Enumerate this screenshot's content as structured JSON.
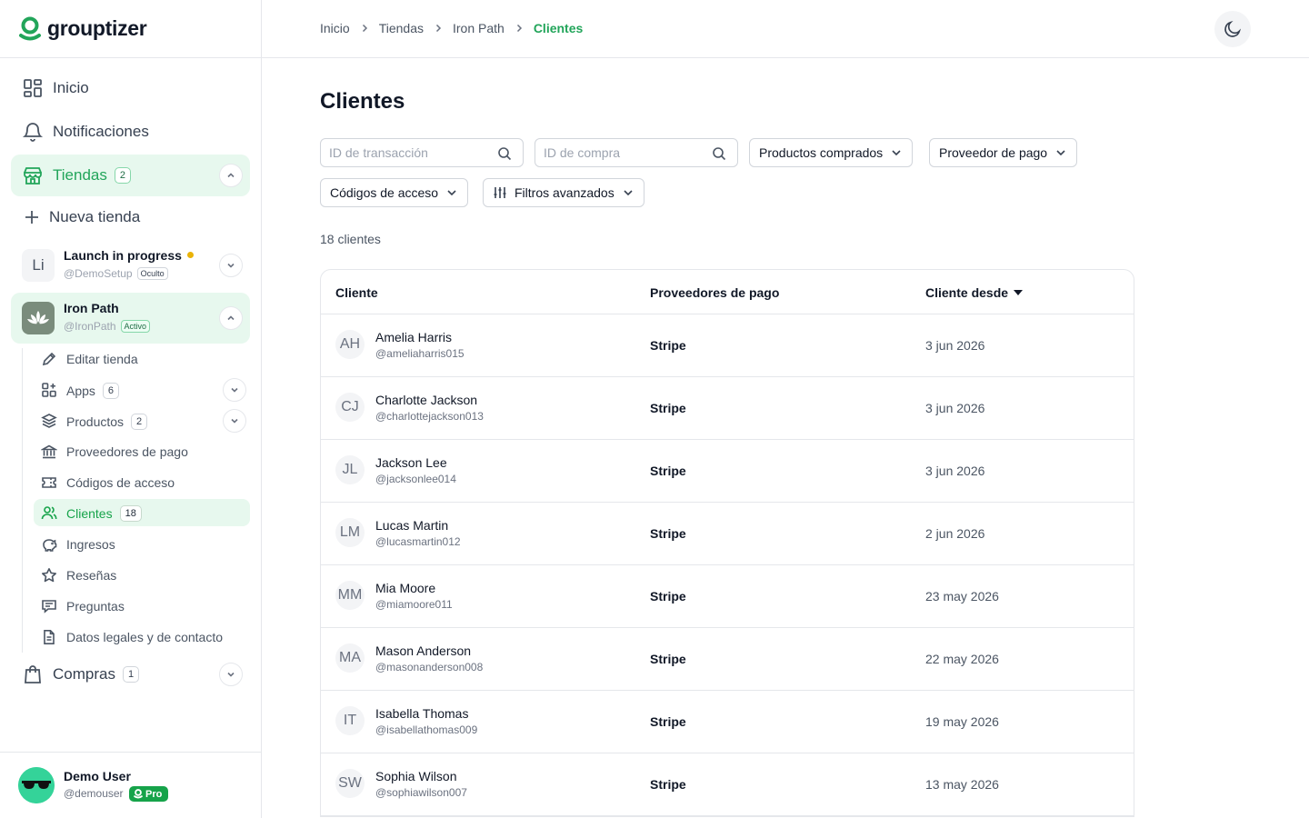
{
  "brand": {
    "name": "grouptizer"
  },
  "sidebar": {
    "home": "Inicio",
    "notifications": "Notificaciones",
    "stores": {
      "label": "Tiendas",
      "count": "2"
    },
    "new_store": "Nueva tienda",
    "store_list": [
      {
        "initials": "Li",
        "name": "Launch in progress",
        "handle": "@DemoSetup",
        "tag": "Oculto",
        "status_dot": "#eab308"
      },
      {
        "initials": "",
        "name": "Iron Path",
        "handle": "@IronPath",
        "tag": "Activo"
      }
    ],
    "store_menu": {
      "edit": "Editar tienda",
      "apps": {
        "label": "Apps",
        "count": "6"
      },
      "products": {
        "label": "Productos",
        "count": "2"
      },
      "payment_providers": "Proveedores de pago",
      "access_codes": "Códigos de acceso",
      "clients": {
        "label": "Clientes",
        "count": "18"
      },
      "income": "Ingresos",
      "reviews": "Reseñas",
      "questions": "Preguntas",
      "legal": "Datos legales y de contacto"
    },
    "purchases": {
      "label": "Compras",
      "count": "1"
    },
    "user": {
      "name": "Demo User",
      "handle": "@demouser",
      "plan": "Pro"
    }
  },
  "breadcrumb": [
    "Inicio",
    "Tiendas",
    "Iron Path",
    "Clientes"
  ],
  "page": {
    "title": "Clientes",
    "filters": {
      "transaction_placeholder": "ID de transacción",
      "purchase_placeholder": "ID de compra",
      "products": "Productos comprados",
      "provider": "Proveedor de pago",
      "access_codes": "Códigos de acceso",
      "advanced": "Filtros avanzados"
    },
    "count_label": "18 clientes"
  },
  "table": {
    "columns": [
      "Cliente",
      "Proveedores de pago",
      "Cliente desde"
    ],
    "rows": [
      {
        "initials": "AH",
        "name": "Amelia Harris",
        "handle": "@ameliaharris015",
        "provider": "Stripe",
        "since": "3 jun 2026"
      },
      {
        "initials": "CJ",
        "name": "Charlotte Jackson",
        "handle": "@charlottejackson013",
        "provider": "Stripe",
        "since": "3 jun 2026"
      },
      {
        "initials": "JL",
        "name": "Jackson Lee",
        "handle": "@jacksonlee014",
        "provider": "Stripe",
        "since": "3 jun 2026"
      },
      {
        "initials": "LM",
        "name": "Lucas Martin",
        "handle": "@lucasmartin012",
        "provider": "Stripe",
        "since": "2 jun 2026"
      },
      {
        "initials": "MM",
        "name": "Mia Moore",
        "handle": "@miamoore011",
        "provider": "Stripe",
        "since": "23 may 2026"
      },
      {
        "initials": "MA",
        "name": "Mason Anderson",
        "handle": "@masonanderson008",
        "provider": "Stripe",
        "since": "22 may 2026"
      },
      {
        "initials": "IT",
        "name": "Isabella Thomas",
        "handle": "@isabellathomas009",
        "provider": "Stripe",
        "since": "19 may 2026"
      },
      {
        "initials": "SW",
        "name": "Sophia Wilson",
        "handle": "@sophiawilson007",
        "provider": "Stripe",
        "since": "13 may 2026"
      }
    ]
  },
  "colors": {
    "accent": "#22a55a",
    "active_bg": "#e7f8ee",
    "border": "#e5e7eb"
  }
}
